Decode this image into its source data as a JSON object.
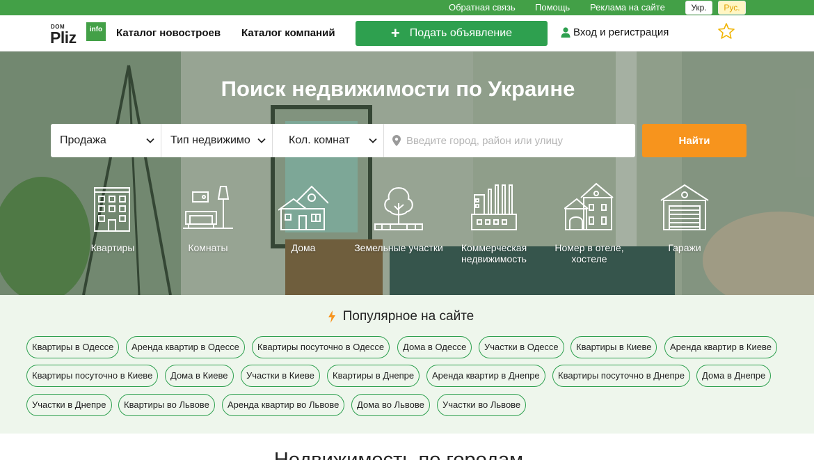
{
  "topbar": {
    "feedback": "Обратная связь",
    "help": "Помощь",
    "ads": "Реклама на сайте",
    "lang_ukr": "Укр.",
    "lang_rus": "Рус."
  },
  "header": {
    "logo_dom": "DOM",
    "logo_pliz": "Pliz",
    "logo_info": "info",
    "catalog_new": "Каталог новостроев",
    "catalog_companies": "Каталог компаний",
    "post_ad": "Подать объявление",
    "login": "Вход и регистрация"
  },
  "hero": {
    "title": "Поиск недвижимости по Украине",
    "deal_select": "Продажа",
    "type_select": "Тип недвижимо",
    "rooms_select": "Кол. комнат",
    "search_placeholder": "Введите город, район или улицу",
    "find_button": "Найти",
    "categories": [
      {
        "label": "Квартиры",
        "icon": "apartment-building-icon"
      },
      {
        "label": "Комнаты",
        "icon": "room-interior-icon"
      },
      {
        "label": "Дома",
        "icon": "house-icon"
      },
      {
        "label": "Земельные участки",
        "icon": "land-plot-tree-icon"
      },
      {
        "label": "Коммерческая недвижимость",
        "icon": "factory-icon"
      },
      {
        "label": "Номер в отеле, хостеле",
        "icon": "hotel-icon"
      },
      {
        "label": "Гаражи",
        "icon": "garage-icon"
      }
    ]
  },
  "popular": {
    "title": "Популярное на сайте",
    "tags": [
      "Квартиры в Одессе",
      "Аренда квартир в Одессе",
      "Квартиры посуточно в Одессе",
      "Дома в Одессе",
      "Участки в Одессе",
      "Квартиры в Киеве",
      "Аренда квартир в Киеве",
      "Квартиры посуточно в Киеве",
      "Дома в Киеве",
      "Участки в Киеве",
      "Квартиры в Днепре",
      "Аренда квартир в Днепре",
      "Квартиры посуточно в Днепре",
      "Дома в Днепре",
      "Участки в Днепре",
      "Квартиры во Львове",
      "Аренда квартир во Львове",
      "Дома во Львове",
      "Участки во Львове"
    ]
  },
  "cities": {
    "title": "Недвижимость по городам"
  },
  "colors": {
    "brand_green": "#43a047",
    "button_green": "#2ea04f",
    "accent_orange": "#f7941d",
    "popular_bg": "#eef6ec"
  }
}
